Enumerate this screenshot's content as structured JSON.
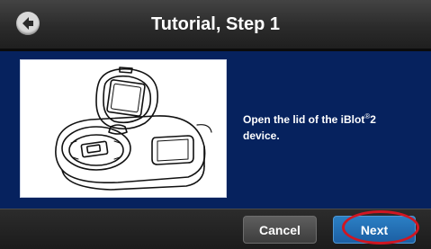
{
  "header": {
    "title": "Tutorial, Step 1",
    "back_icon": "back-arrow-icon"
  },
  "content": {
    "illustration_icon": "iblot2-device-open-lid-illustration",
    "instruction_main": "Open the lid of the iBlot",
    "instruction_mark": "®",
    "instruction_suffix": "2",
    "instruction_line2": "device."
  },
  "footer": {
    "cancel_label": "Cancel",
    "next_label": "Next"
  },
  "colors": {
    "background": "#06225e",
    "titlebar": "#2b2b2b",
    "next_button": "#1c5fa3",
    "cancel_button": "#4a4a4a",
    "highlight": "#d01622"
  }
}
